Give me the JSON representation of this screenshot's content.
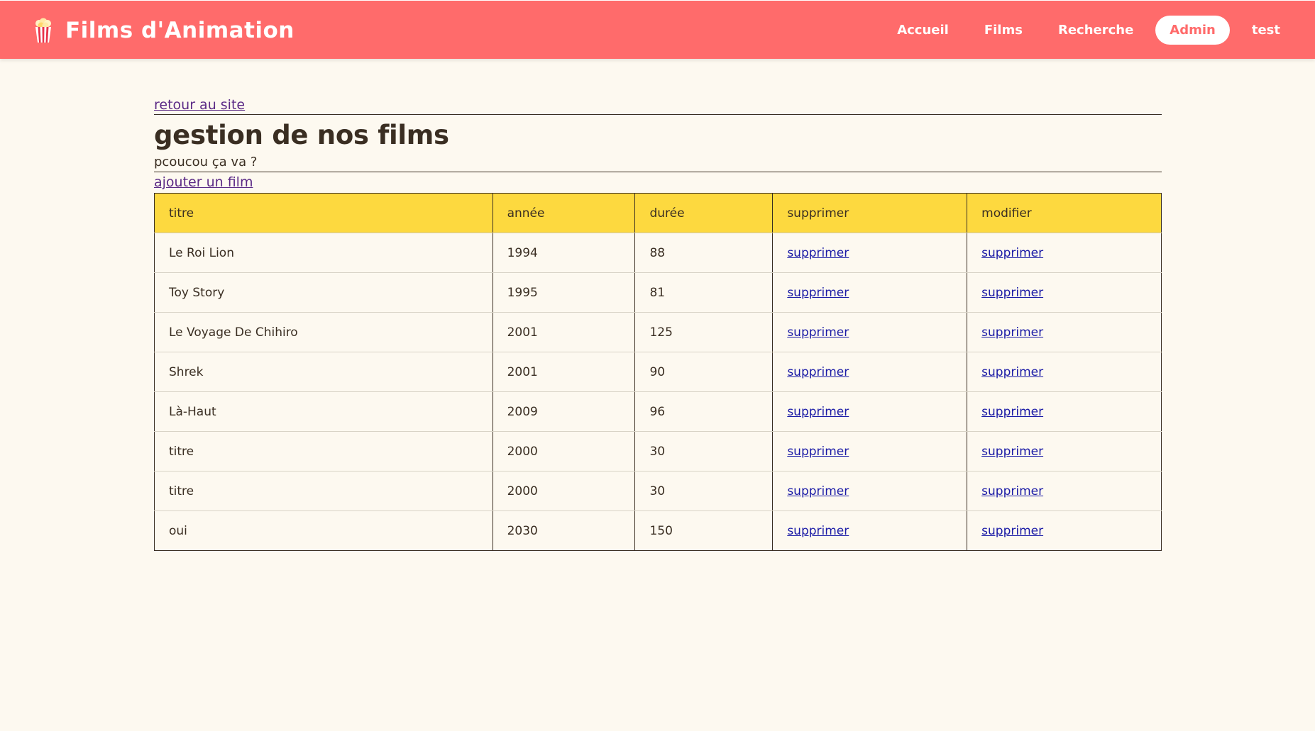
{
  "header": {
    "brand_title": "Films d'Animation",
    "brand_icon": "popcorn-icon",
    "nav": [
      {
        "label": "Accueil",
        "active": false
      },
      {
        "label": "Films",
        "active": false
      },
      {
        "label": "Recherche",
        "active": false
      },
      {
        "label": "Admin",
        "active": true
      },
      {
        "label": "test",
        "active": false
      }
    ],
    "colors": {
      "bar": "#ff6b6b",
      "active_pill": "#ffffff"
    }
  },
  "main": {
    "back_link": "retour au site",
    "title": "gestion de nos films",
    "subtitle": "pcoucou ça va ?",
    "add_link": "ajouter un film",
    "table": {
      "columns": [
        "titre",
        "année",
        "durée",
        "supprimer",
        "modifier"
      ],
      "rows": [
        {
          "titre": "Le Roi Lion",
          "annee": "1994",
          "duree": "88",
          "supprimer": "supprimer",
          "modifier": "supprimer"
        },
        {
          "titre": "Toy Story",
          "annee": "1995",
          "duree": "81",
          "supprimer": "supprimer",
          "modifier": "supprimer"
        },
        {
          "titre": "Le Voyage De Chihiro",
          "annee": "2001",
          "duree": "125",
          "supprimer": "supprimer",
          "modifier": "supprimer"
        },
        {
          "titre": "Shrek",
          "annee": "2001",
          "duree": "90",
          "supprimer": "supprimer",
          "modifier": "supprimer"
        },
        {
          "titre": "Là-Haut",
          "annee": "2009",
          "duree": "96",
          "supprimer": "supprimer",
          "modifier": "supprimer"
        },
        {
          "titre": "titre",
          "annee": "2000",
          "duree": "30",
          "supprimer": "supprimer",
          "modifier": "supprimer"
        },
        {
          "titre": "titre",
          "annee": "2000",
          "duree": "30",
          "supprimer": "supprimer",
          "modifier": "supprimer"
        },
        {
          "titre": "oui",
          "annee": "2030",
          "duree": "150",
          "supprimer": "supprimer",
          "modifier": "supprimer"
        }
      ],
      "colors": {
        "header_bg": "#fdd93f",
        "link": "#1a1aa6"
      }
    }
  }
}
